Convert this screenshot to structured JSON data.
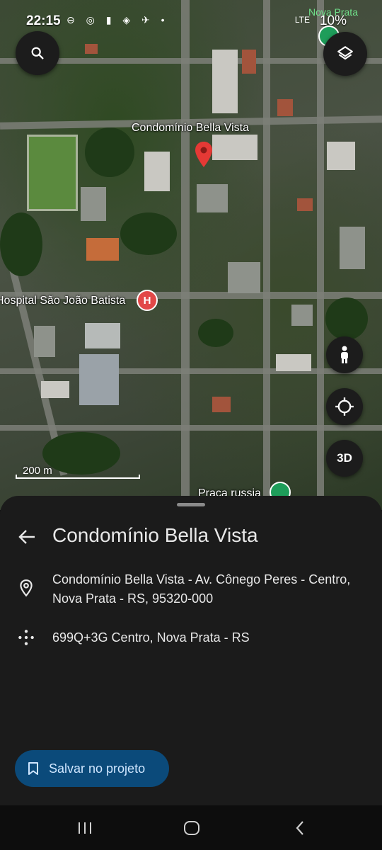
{
  "status_bar": {
    "time": "22:15",
    "battery": "10%",
    "network": "LTE",
    "corner_place": "Nova Prata"
  },
  "map": {
    "selected_place_label": "Condomínio Bella Vista",
    "hospital_label": "Hospital São João Batista",
    "park_label": "Praça russia",
    "scale": "200 m",
    "button_3d": "3D",
    "icons": {
      "search": "search-icon",
      "layers": "layers-icon",
      "street_view": "pegman-icon",
      "my_location": "my-location-icon"
    }
  },
  "sheet": {
    "title": "Condomínio Bella Vista",
    "address": "Condomínio Bella Vista - Av. Cônego Peres - Centro, Nova Prata - RS, 95320-000",
    "plus_code": "699Q+3G Centro, Nova Prata - RS",
    "save_button": "Salvar no projeto"
  },
  "colors": {
    "sheet_bg": "#1b1b1b",
    "save_button_bg": "#0b4a7a",
    "pin": "#e53935",
    "hospital": "#e24848",
    "park": "#1e9d5a"
  }
}
